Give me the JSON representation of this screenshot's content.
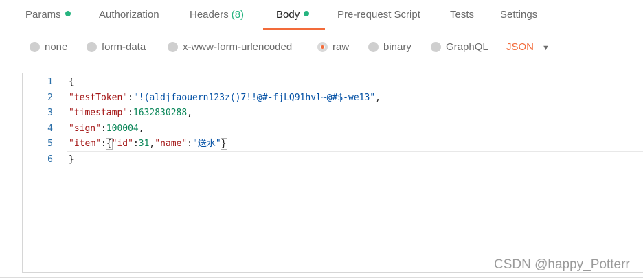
{
  "tabs": {
    "params": "Params",
    "authorization": "Authorization",
    "headers": "Headers",
    "headers_count": "(8)",
    "body": "Body",
    "prerequest": "Pre-request Script",
    "tests": "Tests",
    "settings": "Settings"
  },
  "body_types": {
    "none": "none",
    "form_data": "form-data",
    "urlencoded": "x-www-form-urlencoded",
    "raw": "raw",
    "binary": "binary",
    "graphql": "GraphQL",
    "selected": "raw",
    "format": "JSON"
  },
  "editor": {
    "line_numbers": [
      "1",
      "2",
      "3",
      "4",
      "5",
      "6"
    ],
    "lines": {
      "l1": "{",
      "l2_key": "\"testToken\"",
      "l2_val": "\"!(aldjfaouern123z()7!!@#-fjLQ91hvl~@#$-we13\"",
      "l3_key": "\"timestamp\"",
      "l3_val": "1632830288",
      "l4_key": "\"sign\"",
      "l4_val": "100004",
      "l5_key": "\"item\"",
      "l5_id_key": "\"id\"",
      "l5_id_val": "31",
      "l5_name_key": "\"name\"",
      "l5_name_val": "\"送水\"",
      "l6": "}"
    }
  },
  "watermark": "CSDN @happy_Potterr",
  "colors": {
    "accent": "#f26b3a",
    "active_dot": "#26b47f",
    "json_key": "#a31515",
    "json_string": "#0451a5",
    "json_number": "#098658",
    "line_number": "#2a6ea8"
  }
}
